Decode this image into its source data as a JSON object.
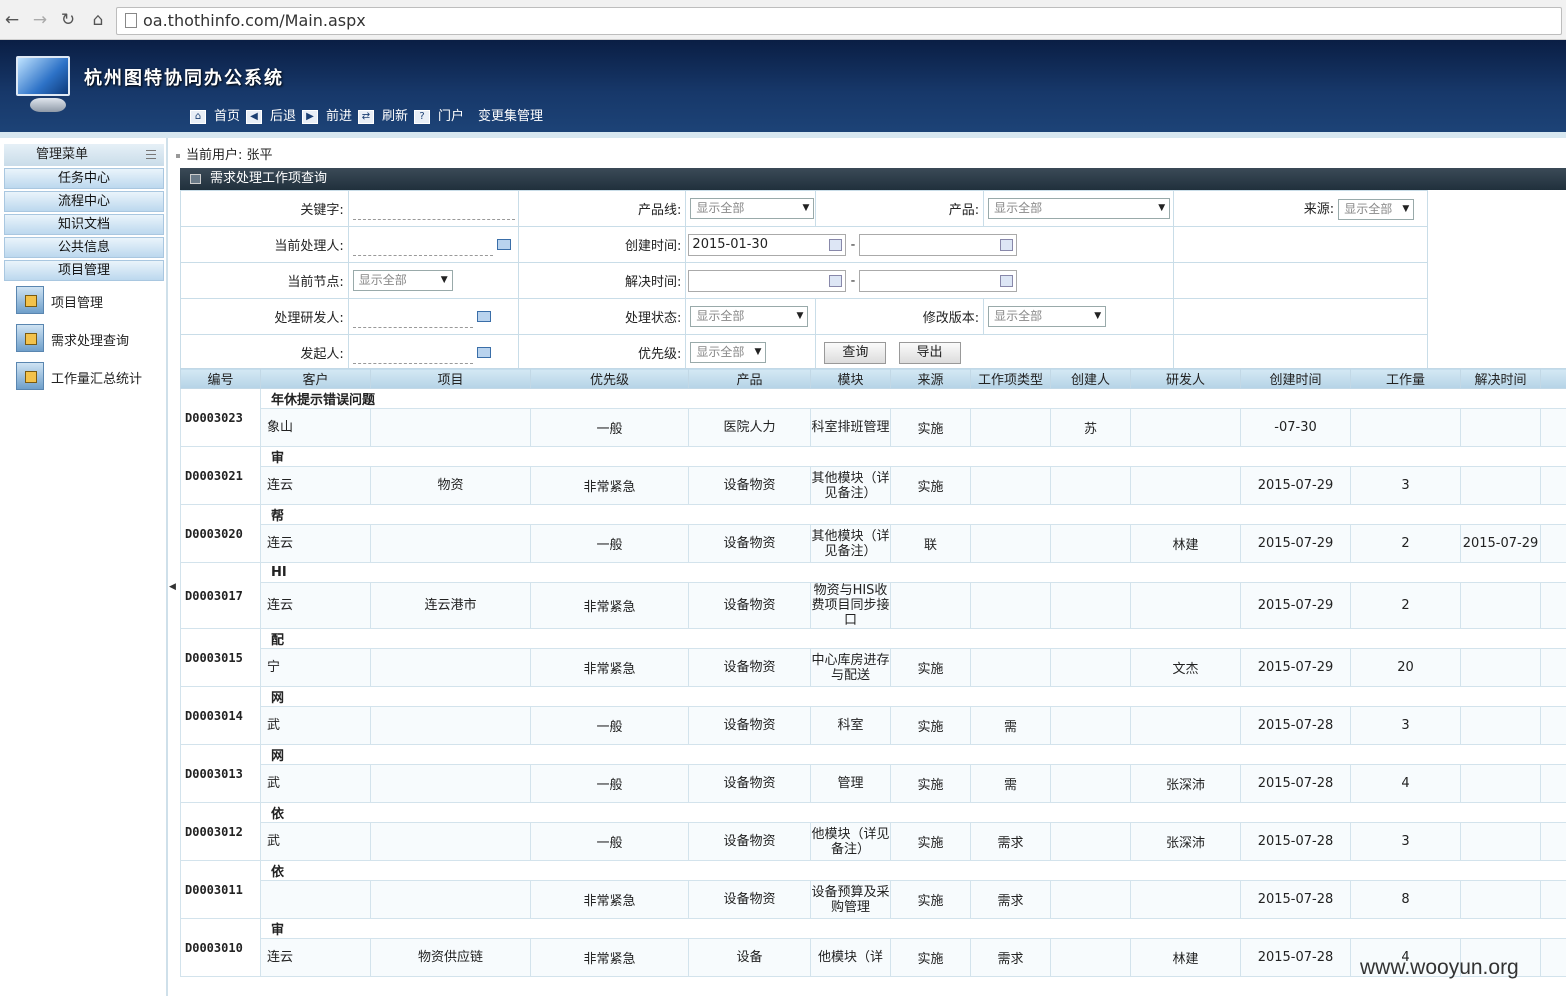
{
  "browser": {
    "url": "oa.thothinfo.com/Main.aspx"
  },
  "app": {
    "title": "杭州图特协同办公系统",
    "nav": [
      "首页",
      "后退",
      "前进",
      "刷新",
      "门户",
      "变更集管理"
    ]
  },
  "sidebar": {
    "header": "管理菜单",
    "buttons": [
      "任务中心",
      "流程中心",
      "知识文档",
      "公共信息",
      "项目管理"
    ],
    "links": [
      "项目管理",
      "需求处理查询",
      "工作量汇总统计"
    ]
  },
  "main": {
    "current_user": "当前用户: 张平",
    "section_title": "需求处理工作项查询",
    "form": {
      "keyword_label": "关键字:",
      "product_line_label": "产品线:",
      "product_label": "产品:",
      "source_label": "来源:",
      "handler_label": "当前处理人:",
      "created_label": "创建时间:",
      "created_from": "2015-01-30",
      "node_label": "当前节点:",
      "resolved_label": "解决时间:",
      "developer_label": "处理研发人:",
      "status_label": "处理状态:",
      "version_label": "修改版本:",
      "initiator_label": "发起人:",
      "priority_label": "优先级:",
      "show_all": "显示全部",
      "dash": "-",
      "query_btn": "查询",
      "export_btn": "导出"
    },
    "table": {
      "headers": [
        "编号",
        "客户",
        "项目",
        "优先级",
        "产品",
        "模块",
        "来源",
        "工作项类型",
        "创建人",
        "研发人",
        "创建时间",
        "工作量",
        "解决时间"
      ],
      "rows": [
        {
          "id": "D0003023",
          "title": "年休提示错误问题",
          "customer": "象山",
          "project": "",
          "priority": "一般",
          "product": "医院人力",
          "module": "科室排班管理",
          "source": "实施",
          "type": "",
          "creator": "苏",
          "developer": "",
          "created": "-07-30",
          "workload": "",
          "resolved": ""
        },
        {
          "id": "D0003021",
          "title": "审",
          "customer": "连云",
          "project": "物资",
          "priority": "非常紧急",
          "product": "设备物资",
          "module": "其他模块（详见备注）",
          "source": "实施",
          "type": "",
          "creator": "",
          "developer": "",
          "created": "2015-07-29",
          "workload": "3",
          "resolved": ""
        },
        {
          "id": "D0003020",
          "title": "帮",
          "customer": "连云",
          "project": "",
          "priority": "一般",
          "product": "设备物资",
          "module": "其他模块（详见备注）",
          "source": "联",
          "type": "",
          "creator": "",
          "developer": "林建",
          "created": "2015-07-29",
          "workload": "2",
          "resolved": "2015-07-29"
        },
        {
          "id": "D0003017",
          "title": "HI",
          "customer": "连云",
          "project": "连云港市",
          "priority": "非常紧急",
          "product": "设备物资",
          "module": "物资与HIS收费项目同步接口",
          "source": "",
          "type": "",
          "creator": "",
          "developer": "",
          "created": "2015-07-29",
          "workload": "2",
          "resolved": ""
        },
        {
          "id": "D0003015",
          "title": "配",
          "customer": "宁",
          "project": "",
          "priority": "非常紧急",
          "product": "设备物资",
          "module": "中心库房进存与配送",
          "source": "实施",
          "type": "",
          "creator": "",
          "developer": "文杰",
          "created": "2015-07-29",
          "workload": "20",
          "resolved": ""
        },
        {
          "id": "D0003014",
          "title": "网",
          "customer": "武",
          "project": "",
          "priority": "一般",
          "product": "设备物资",
          "module": "科室",
          "source": "实施",
          "type": "需",
          "creator": "",
          "developer": "",
          "created": "2015-07-28",
          "workload": "3",
          "resolved": ""
        },
        {
          "id": "D0003013",
          "title": "网",
          "customer": "武",
          "project": "",
          "priority": "一般",
          "product": "设备物资",
          "module": "管理",
          "source": "实施",
          "type": "需",
          "creator": "",
          "developer": "张深沛",
          "created": "2015-07-28",
          "workload": "4",
          "resolved": ""
        },
        {
          "id": "D0003012",
          "title": "依",
          "customer": "武",
          "project": "",
          "priority": "一般",
          "product": "设备物资",
          "module": "他模块（详见备注）",
          "source": "实施",
          "type": "需求",
          "creator": "",
          "developer": "张深沛",
          "created": "2015-07-28",
          "workload": "3",
          "resolved": ""
        },
        {
          "id": "D0003011",
          "title": "依",
          "customer": "",
          "project": "",
          "priority": "非常紧急",
          "product": "设备物资",
          "module": "设备预算及采购管理",
          "source": "实施",
          "type": "需求",
          "creator": "",
          "developer": "",
          "created": "2015-07-28",
          "workload": "8",
          "resolved": ""
        },
        {
          "id": "D0003010",
          "title": "审",
          "customer": "连云",
          "project": "物资供应链",
          "priority": "非常紧急",
          "product": "设备",
          "module": "他模块（详",
          "source": "实施",
          "type": "需求",
          "creator": "",
          "developer": "林建",
          "created": "2015-07-28",
          "workload": "4",
          "resolved": ""
        }
      ]
    }
  },
  "watermark": "www.wooyun.org"
}
